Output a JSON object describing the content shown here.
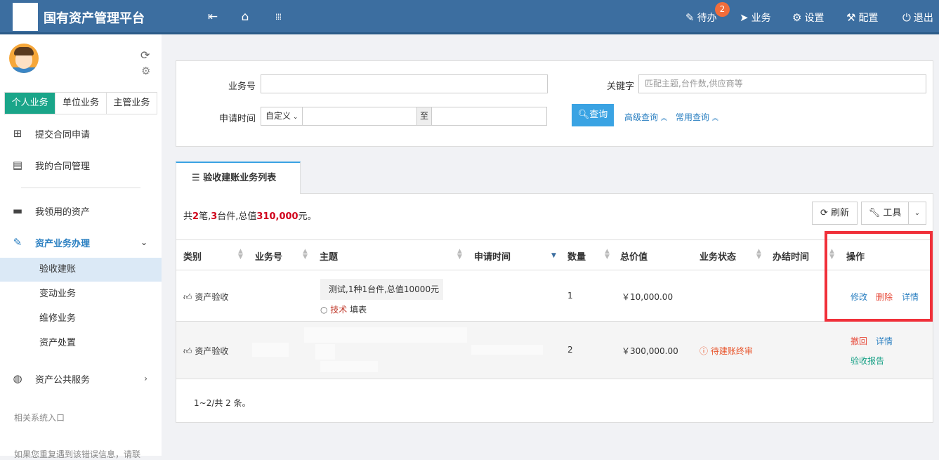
{
  "topbar": {
    "title": "国有资产管理平台",
    "badge": "2",
    "todo": "待办",
    "business": "业务",
    "settings": "设置",
    "config": "配置",
    "logout": "退出"
  },
  "sidebar": {
    "tabs": [
      "个人业务",
      "单位业务",
      "主管业务"
    ],
    "menu": {
      "submit_contract": "提交合同申请",
      "my_contracts": "我的合同管理",
      "my_assets": "我领用的资产",
      "asset_ops": "资产业务办理",
      "public_service": "资产公共服务"
    },
    "sub": [
      "验收建账",
      "变动业务",
      "维修业务",
      "资产处置"
    ],
    "related": "相关系统入口",
    "footer_note": "如果您重复遇到该错误信息，请联"
  },
  "search": {
    "biz_no_label": "业务号",
    "keyword_label": "关键字",
    "keyword_placeholder": "匹配主题,台件数,供应商等",
    "apply_time_label": "申请时间",
    "custom_option": "自定义",
    "to": "至",
    "query_btn": "查询",
    "advanced": "高级查询",
    "common": "常用查询"
  },
  "list": {
    "tab": "验收建账业务列表",
    "summary_prefix": "共",
    "count": "2",
    "count_unit": "笔,",
    "units": "3",
    "units_unit": "台件,总值",
    "total": "310,000",
    "total_unit": "元。",
    "refresh": "刷新",
    "tools": "工具",
    "headers": [
      "类别",
      "业务号",
      "主题",
      "申请时间",
      "数量",
      "总价值",
      "业务状态",
      "办结时间",
      "操作"
    ],
    "rows": [
      {
        "category": "资产验收",
        "subject": "测试,1种1台件,总值10000元",
        "sub_tag": "技术",
        "sub_text": "填表",
        "qty": "1",
        "value": "￥10,000.00",
        "status": "",
        "actions": [
          "修改",
          "删除",
          "详情"
        ]
      },
      {
        "category": "资产验收",
        "qty": "2",
        "value": "￥300,000.00",
        "status": "待建账终审",
        "actions": [
          "撤回",
          "详情",
          "验收报告"
        ]
      }
    ],
    "pager": "1~2/共 2 条。"
  }
}
